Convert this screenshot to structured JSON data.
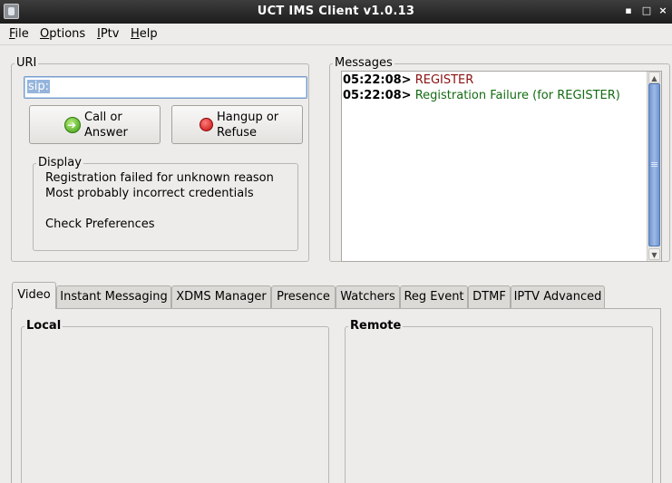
{
  "window": {
    "title": "UCT IMS Client v1.0.13",
    "minimize": "▪",
    "maximize": "□",
    "close": "×"
  },
  "menu": [
    {
      "accel": "F",
      "rest": "ile"
    },
    {
      "accel": "O",
      "rest": "ptions"
    },
    {
      "accel": "I",
      "rest": "Ptv"
    },
    {
      "accel": "H",
      "rest": "elp"
    }
  ],
  "uri": {
    "label": "URI",
    "value": "sip:"
  },
  "buttons": {
    "call": {
      "line1": "Call or",
      "line2": "Answer",
      "icon": "call-arrow-icon"
    },
    "hangup": {
      "line1": "Hangup or",
      "line2": "Refuse",
      "icon": "hangup-icon"
    }
  },
  "display": {
    "label": "Display",
    "lines": [
      "Registration failed for unknown reason",
      "Most probably incorrect credentials",
      "",
      "Check Preferences"
    ]
  },
  "messages": {
    "label": "Messages",
    "items": [
      {
        "time": "05:22:08>",
        "text": "REGISTER",
        "color": "#8b1010"
      },
      {
        "time": "05:22:08>",
        "text": "Registration Failure (for REGISTER)",
        "color": "#136b13"
      }
    ]
  },
  "tabs": [
    "Video",
    "Instant Messaging",
    "XDMS Manager",
    "Presence",
    "Watchers",
    "Reg Event",
    "DTMF",
    "IPTV Advanced"
  ],
  "video": {
    "local_label": "Local",
    "remote_label": "Remote"
  }
}
